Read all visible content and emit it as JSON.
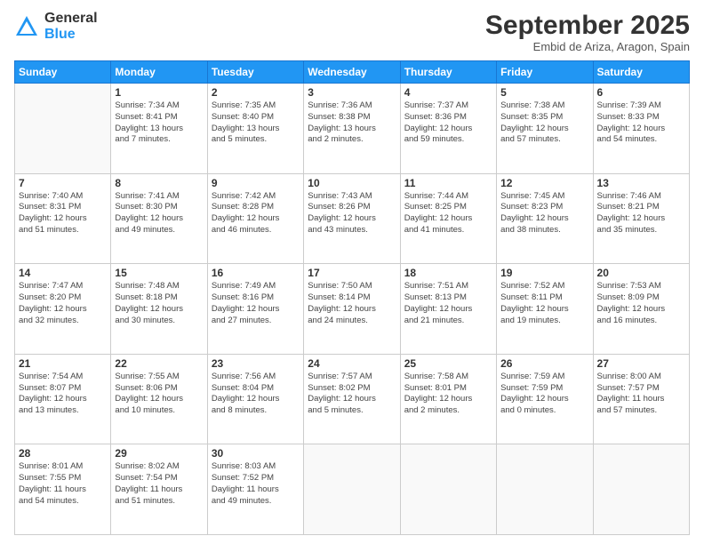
{
  "header": {
    "logo_general": "General",
    "logo_blue": "Blue",
    "month_title": "September 2025",
    "subtitle": "Embid de Ariza, Aragon, Spain"
  },
  "weekdays": [
    "Sunday",
    "Monday",
    "Tuesday",
    "Wednesday",
    "Thursday",
    "Friday",
    "Saturday"
  ],
  "weeks": [
    [
      {
        "day": "",
        "info": ""
      },
      {
        "day": "1",
        "info": "Sunrise: 7:34 AM\nSunset: 8:41 PM\nDaylight: 13 hours\nand 7 minutes."
      },
      {
        "day": "2",
        "info": "Sunrise: 7:35 AM\nSunset: 8:40 PM\nDaylight: 13 hours\nand 5 minutes."
      },
      {
        "day": "3",
        "info": "Sunrise: 7:36 AM\nSunset: 8:38 PM\nDaylight: 13 hours\nand 2 minutes."
      },
      {
        "day": "4",
        "info": "Sunrise: 7:37 AM\nSunset: 8:36 PM\nDaylight: 12 hours\nand 59 minutes."
      },
      {
        "day": "5",
        "info": "Sunrise: 7:38 AM\nSunset: 8:35 PM\nDaylight: 12 hours\nand 57 minutes."
      },
      {
        "day": "6",
        "info": "Sunrise: 7:39 AM\nSunset: 8:33 PM\nDaylight: 12 hours\nand 54 minutes."
      }
    ],
    [
      {
        "day": "7",
        "info": "Sunrise: 7:40 AM\nSunset: 8:31 PM\nDaylight: 12 hours\nand 51 minutes."
      },
      {
        "day": "8",
        "info": "Sunrise: 7:41 AM\nSunset: 8:30 PM\nDaylight: 12 hours\nand 49 minutes."
      },
      {
        "day": "9",
        "info": "Sunrise: 7:42 AM\nSunset: 8:28 PM\nDaylight: 12 hours\nand 46 minutes."
      },
      {
        "day": "10",
        "info": "Sunrise: 7:43 AM\nSunset: 8:26 PM\nDaylight: 12 hours\nand 43 minutes."
      },
      {
        "day": "11",
        "info": "Sunrise: 7:44 AM\nSunset: 8:25 PM\nDaylight: 12 hours\nand 41 minutes."
      },
      {
        "day": "12",
        "info": "Sunrise: 7:45 AM\nSunset: 8:23 PM\nDaylight: 12 hours\nand 38 minutes."
      },
      {
        "day": "13",
        "info": "Sunrise: 7:46 AM\nSunset: 8:21 PM\nDaylight: 12 hours\nand 35 minutes."
      }
    ],
    [
      {
        "day": "14",
        "info": "Sunrise: 7:47 AM\nSunset: 8:20 PM\nDaylight: 12 hours\nand 32 minutes."
      },
      {
        "day": "15",
        "info": "Sunrise: 7:48 AM\nSunset: 8:18 PM\nDaylight: 12 hours\nand 30 minutes."
      },
      {
        "day": "16",
        "info": "Sunrise: 7:49 AM\nSunset: 8:16 PM\nDaylight: 12 hours\nand 27 minutes."
      },
      {
        "day": "17",
        "info": "Sunrise: 7:50 AM\nSunset: 8:14 PM\nDaylight: 12 hours\nand 24 minutes."
      },
      {
        "day": "18",
        "info": "Sunrise: 7:51 AM\nSunset: 8:13 PM\nDaylight: 12 hours\nand 21 minutes."
      },
      {
        "day": "19",
        "info": "Sunrise: 7:52 AM\nSunset: 8:11 PM\nDaylight: 12 hours\nand 19 minutes."
      },
      {
        "day": "20",
        "info": "Sunrise: 7:53 AM\nSunset: 8:09 PM\nDaylight: 12 hours\nand 16 minutes."
      }
    ],
    [
      {
        "day": "21",
        "info": "Sunrise: 7:54 AM\nSunset: 8:07 PM\nDaylight: 12 hours\nand 13 minutes."
      },
      {
        "day": "22",
        "info": "Sunrise: 7:55 AM\nSunset: 8:06 PM\nDaylight: 12 hours\nand 10 minutes."
      },
      {
        "day": "23",
        "info": "Sunrise: 7:56 AM\nSunset: 8:04 PM\nDaylight: 12 hours\nand 8 minutes."
      },
      {
        "day": "24",
        "info": "Sunrise: 7:57 AM\nSunset: 8:02 PM\nDaylight: 12 hours\nand 5 minutes."
      },
      {
        "day": "25",
        "info": "Sunrise: 7:58 AM\nSunset: 8:01 PM\nDaylight: 12 hours\nand 2 minutes."
      },
      {
        "day": "26",
        "info": "Sunrise: 7:59 AM\nSunset: 7:59 PM\nDaylight: 12 hours\nand 0 minutes."
      },
      {
        "day": "27",
        "info": "Sunrise: 8:00 AM\nSunset: 7:57 PM\nDaylight: 11 hours\nand 57 minutes."
      }
    ],
    [
      {
        "day": "28",
        "info": "Sunrise: 8:01 AM\nSunset: 7:55 PM\nDaylight: 11 hours\nand 54 minutes."
      },
      {
        "day": "29",
        "info": "Sunrise: 8:02 AM\nSunset: 7:54 PM\nDaylight: 11 hours\nand 51 minutes."
      },
      {
        "day": "30",
        "info": "Sunrise: 8:03 AM\nSunset: 7:52 PM\nDaylight: 11 hours\nand 49 minutes."
      },
      {
        "day": "",
        "info": ""
      },
      {
        "day": "",
        "info": ""
      },
      {
        "day": "",
        "info": ""
      },
      {
        "day": "",
        "info": ""
      }
    ]
  ]
}
